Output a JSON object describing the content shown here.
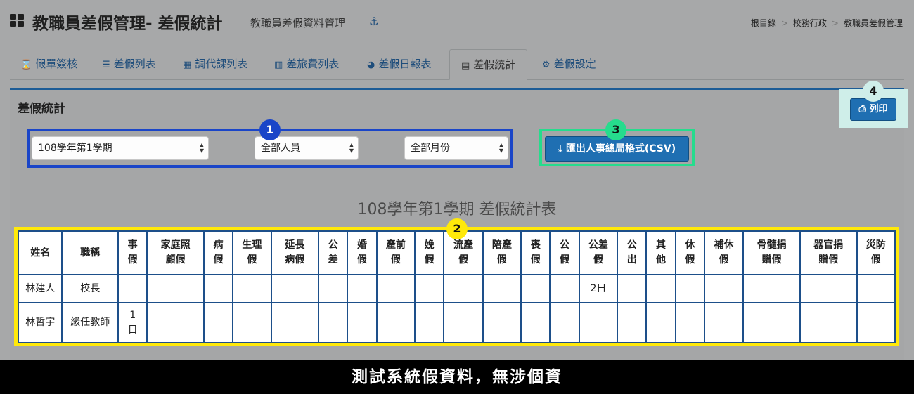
{
  "header": {
    "title": "教職員差假管理- 差假統計",
    "subtitle": "教職員差假資料管理",
    "anchor_icon": "⚓",
    "breadcrumb": [
      "根目錄",
      "校務行政",
      "教職員差假管理"
    ],
    "breadcrumb_sep": ">"
  },
  "tabs": [
    {
      "icon": "⌛",
      "label": "假單簽核"
    },
    {
      "icon": "☰",
      "label": "差假列表"
    },
    {
      "icon": "▦",
      "label": "調代課列表"
    },
    {
      "icon": "▥",
      "label": "差旅費列表"
    },
    {
      "icon": "◕",
      "label": "差假日報表"
    },
    {
      "icon": "▤",
      "label": "差假統計"
    },
    {
      "icon": "⚙",
      "label": "差假設定"
    }
  ],
  "panel": {
    "title": "差假統計"
  },
  "filters": {
    "semester": "108學年第1學期",
    "staff": "全部人員",
    "month": "全部月份"
  },
  "buttons": {
    "export_icon": "⤓",
    "export_label": "匯出人事總局格式(CSV)",
    "print_icon": "⎙",
    "print_label": "列印"
  },
  "badges": [
    "1",
    "2",
    "3",
    "4"
  ],
  "report": {
    "title": "108學年第1學期 差假統計表",
    "columns": [
      "姓名",
      "職稱",
      "事假",
      "家庭照顧假",
      "病假",
      "生理假",
      "延長病假",
      "公差",
      "婚假",
      "產前假",
      "娩假",
      "流產假",
      "陪產假",
      "喪假",
      "公假",
      "公差假",
      "公出",
      "其他",
      "休假",
      "補休假",
      "骨髓捐贈假",
      "器官捐贈假",
      "災防假"
    ],
    "rows": [
      [
        "林建人",
        "校長",
        "",
        "",
        "",
        "",
        "",
        "",
        "",
        "",
        "",
        "",
        "",
        "",
        "",
        "2日",
        "",
        "",
        "",
        "",
        "",
        "",
        ""
      ],
      [
        "林哲宇",
        "級任教師",
        "1日",
        "",
        "",
        "",
        "",
        "",
        "",
        "",
        "",
        "",
        "",
        "",
        "",
        "",
        "",
        "",
        "",
        "",
        "",
        "",
        ""
      ]
    ]
  },
  "caption": "測試系統假資料，無涉個資"
}
